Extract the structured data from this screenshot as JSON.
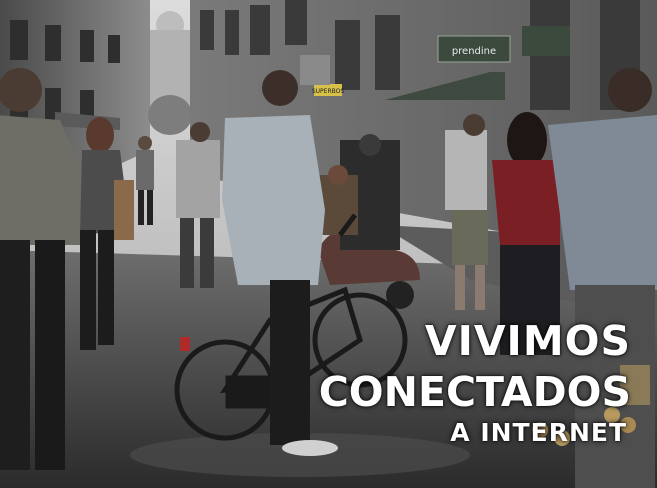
{
  "photo": {
    "description_none": "",
    "signs": {
      "shop_sign": "prendine",
      "small_sign": "SUPERBOS"
    }
  },
  "caption": {
    "line1": "VIVIMOS",
    "line2": "CONECTADOS",
    "line3": "A INTERNET"
  },
  "colors": {
    "text": "#ffffff",
    "red_shirt": "#7a1f24"
  }
}
